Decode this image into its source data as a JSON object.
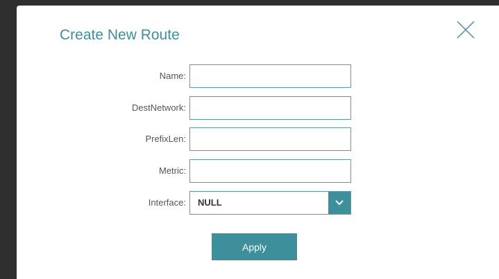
{
  "dialog": {
    "title": "Create New Route",
    "close_icon": "close-icon"
  },
  "fields": {
    "name": {
      "label": "Name:",
      "value": "",
      "placeholder": ""
    },
    "dest_network": {
      "label": "DestNetwork:",
      "value": "",
      "placeholder": ""
    },
    "prefix_len": {
      "label": "PrefixLen:",
      "value": "",
      "placeholder": ""
    },
    "metric": {
      "label": "Metric:",
      "value": "",
      "placeholder": ""
    },
    "interface": {
      "label": "Interface:",
      "selected": "NULL",
      "arrow_icon": "chevron-down-icon"
    }
  },
  "actions": {
    "apply_label": "Apply"
  },
  "colors": {
    "accent": "#3d8f9c",
    "title": "#3f8e9b",
    "border": "#5b9aa6"
  }
}
